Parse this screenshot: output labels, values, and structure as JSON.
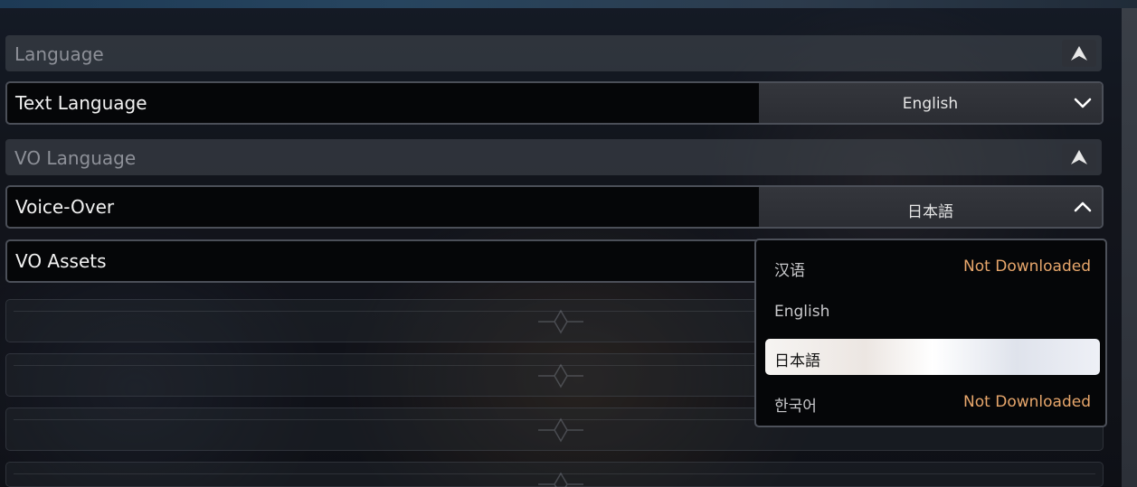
{
  "sections": {
    "language": {
      "title": "Language",
      "rows": [
        {
          "label": "Text Language",
          "value": "English",
          "state": "collapsed"
        }
      ]
    },
    "vo_language": {
      "title": "VO Language",
      "rows": [
        {
          "label": "Voice-Over",
          "value": "日本語",
          "state": "expanded"
        },
        {
          "label": "VO Assets"
        }
      ]
    }
  },
  "voice_over_menu": {
    "options": [
      {
        "label": "汉语",
        "status": "Not Downloaded",
        "selected": false
      },
      {
        "label": "English",
        "status": "",
        "selected": false
      },
      {
        "label": "日本語",
        "status": "",
        "selected": true
      },
      {
        "label": "한국어",
        "status": "Not Downloaded",
        "selected": false
      }
    ]
  },
  "icons": {
    "collapse": "collapse-arrow-icon",
    "chevron_down": "chevron-down-icon",
    "chevron_up": "chevron-up-icon",
    "ornament": "diamond-ornament-icon"
  },
  "colors": {
    "status_accent": "#e7a66b",
    "row_border": "#4b4f58",
    "selected_bg": "#f2f0ee"
  }
}
